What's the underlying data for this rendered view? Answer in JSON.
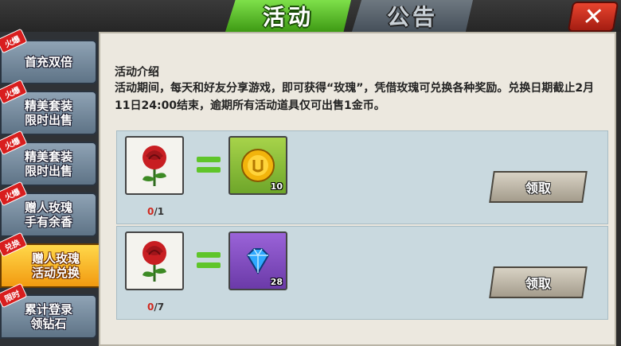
{
  "tabs": [
    {
      "label": "活动",
      "active": true
    },
    {
      "label": "公告",
      "active": false
    }
  ],
  "close_icon": "close-x-icon",
  "sidebar": {
    "items": [
      {
        "label": "首充双倍",
        "tag": "火爆",
        "active": false
      },
      {
        "label": "精美套装\n限时出售",
        "tag": "火爆",
        "active": false
      },
      {
        "label": "精美套装\n限时出售",
        "tag": "火爆",
        "active": false
      },
      {
        "label": "赠人玫瑰\n手有余香",
        "tag": "火爆",
        "active": false
      },
      {
        "label": "赠人玫瑰\n活动兑换",
        "tag": "兑换",
        "active": true
      },
      {
        "label": "累计登录\n领钻石",
        "tag": "限时",
        "active": false
      }
    ]
  },
  "intro": {
    "title": "活动介绍",
    "text": "活动期间，每天和好友分享游戏，即可获得“玫瑰”，凭借玫瑰可兑换各种奖励。兑换日期截止2月11日24:00结束，逾期所有活动道具仅可出售1金币。"
  },
  "rewards": [
    {
      "cost_icon": "rose-icon",
      "reward_icon": "gold-coin-icon",
      "reward_qty": "10",
      "progress_current": "0",
      "progress_rest": "/1",
      "button_label": "领取"
    },
    {
      "cost_icon": "rose-icon",
      "reward_icon": "blue-diamond-icon",
      "reward_qty": "28",
      "progress_current": "0",
      "progress_rest": "/7",
      "button_label": "领取"
    }
  ],
  "colors": {
    "active_tab": "#5cc022",
    "active_sidebar": "#f6b724",
    "close_button": "#d8331f",
    "progress_red": "#d0281e"
  }
}
